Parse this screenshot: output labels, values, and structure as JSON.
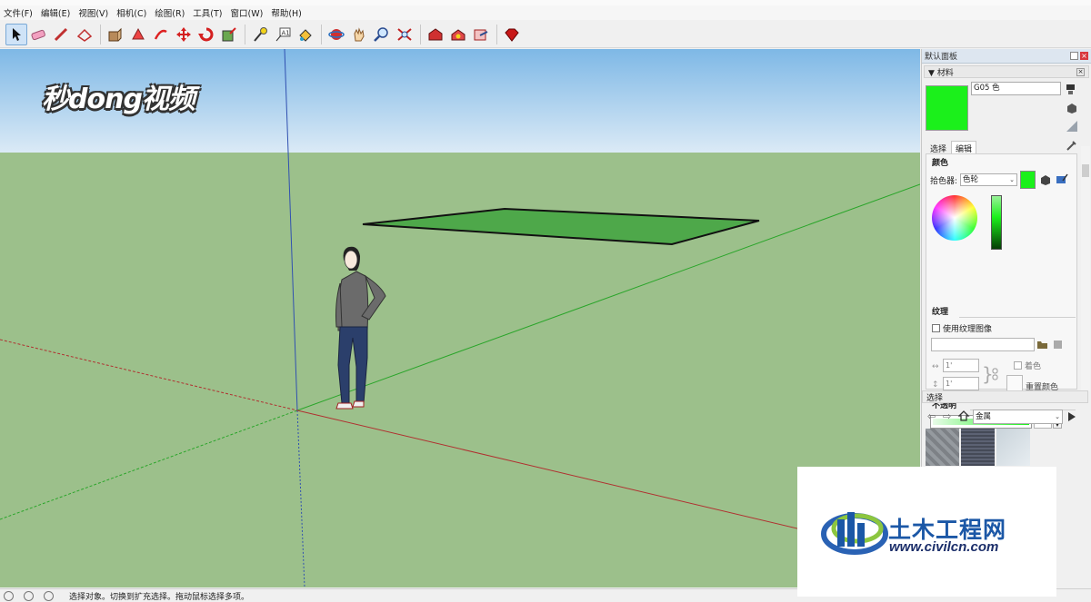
{
  "menu": [
    "文件(F)",
    "编辑(E)",
    "视图(V)",
    "相机(C)",
    "绘图(R)",
    "工具(T)",
    "窗口(W)",
    "帮助(H)"
  ],
  "toolbar": {
    "icons": [
      "select-icon",
      "eraser-icon",
      "paint-bucket-icon",
      "line-icon",
      "rectangle-icon",
      "push-pull-icon",
      "move-icon",
      "rotate-icon",
      "scale-icon",
      "tape-measure-icon",
      "text-icon",
      "paint-icon",
      "orbit-icon",
      "pan-icon",
      "zoom-icon",
      "zoom-extents-icon",
      "3d-warehouse-icon",
      "extension-icon",
      "share-icon",
      "ruby-icon"
    ]
  },
  "watermark_top": "秒dong视频",
  "panel": {
    "title": "默认面板",
    "materials_header": "▼ 材料",
    "material_name": "G05 色",
    "material_color": "#1bf01b",
    "tabs": [
      "选择",
      "编辑"
    ],
    "color_heading": "颜色",
    "picker_label": "拾色器:",
    "picker_value": "色轮",
    "texture_heading": "纹理",
    "use_texture_label": "使用纹理图像",
    "texture_w": "1'",
    "texture_h": "1'",
    "colorize_label": "着色",
    "reset_color_label": "重置颜色",
    "opacity_heading": "不透明",
    "opacity_value": 57,
    "select_header": "选择",
    "library_value": "金属"
  },
  "status": {
    "text": "选择对象。切换到扩充选择。拖动鼠标选择多项。"
  },
  "watermark_site": {
    "name": "土木工程网",
    "url": "www.civilcn.com"
  },
  "colors": {
    "sky_top": "#7fb9e6",
    "sky_bottom": "#dcebf7",
    "ground": "#9cc08b",
    "plane": "#4ea84a",
    "axis_red": "#b03030",
    "axis_green": "#2aaa2a",
    "axis_blue": "#3050b0"
  }
}
